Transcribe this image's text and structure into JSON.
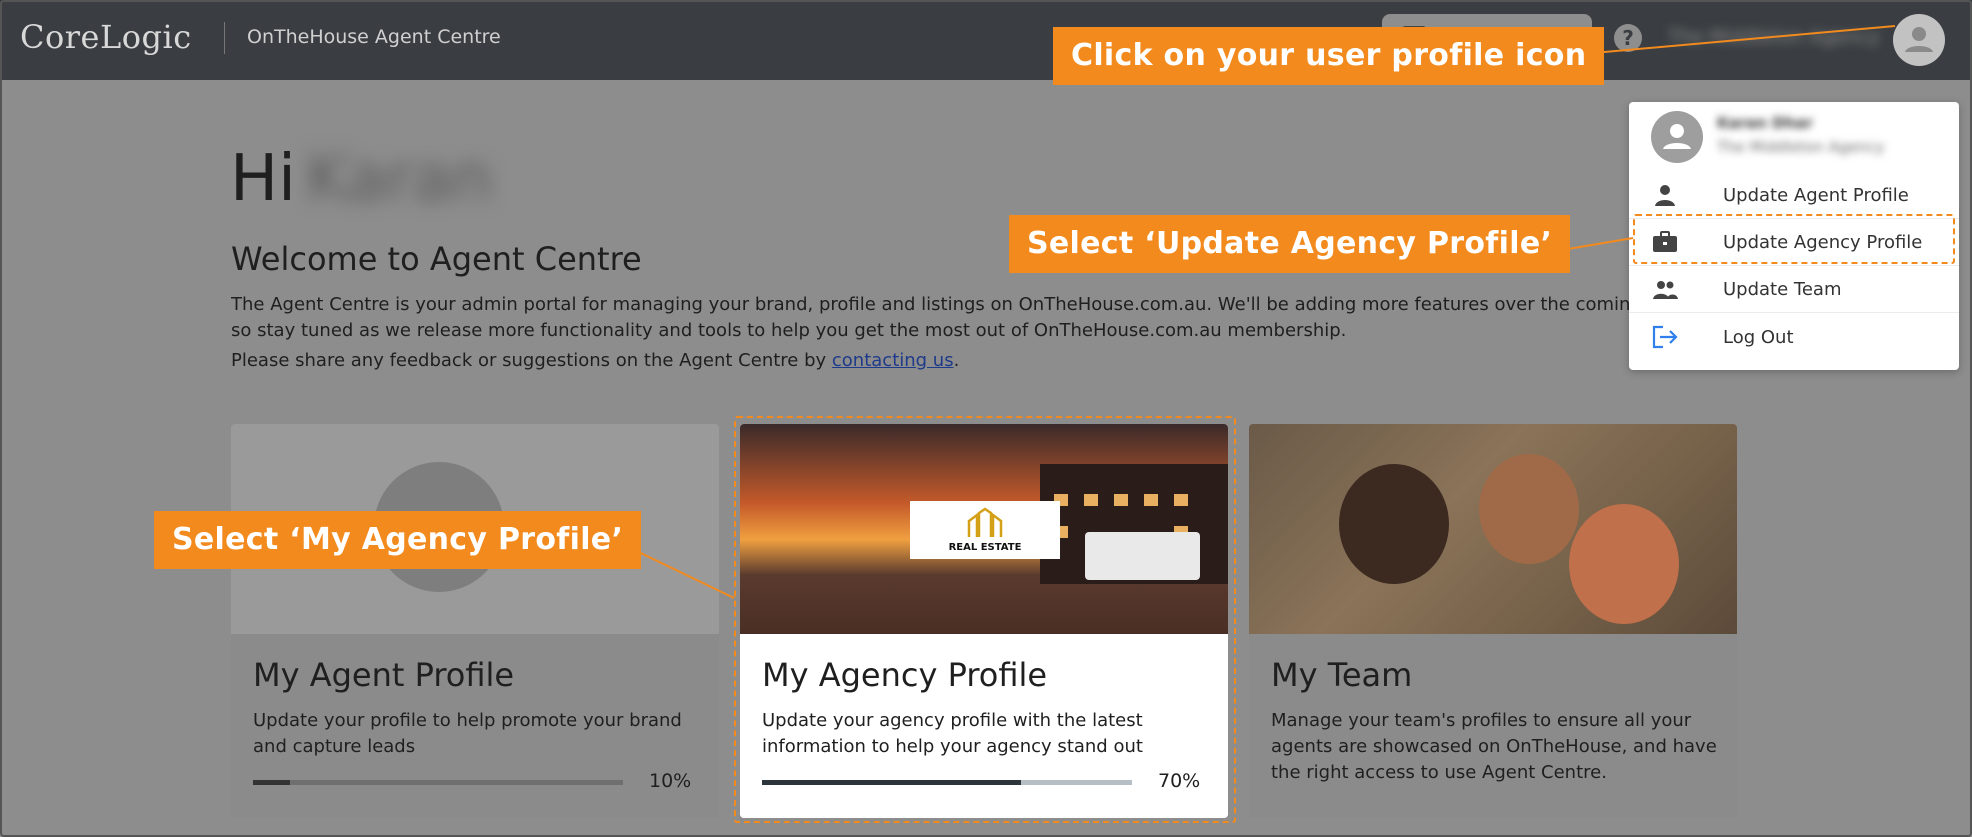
{
  "header": {
    "logo": "CoreLogic",
    "app_name": "OnTheHouse Agent Centre",
    "help": "?",
    "agency_name_blurred": "The Middleton Agency"
  },
  "greeting": {
    "hi": "Hi",
    "name_blurred": "Karan",
    "welcome": "Welcome to Agent Centre",
    "intro_line1": "The Agent Centre is your admin portal for managing your brand, profile and listings on OnTheHouse.com.au. We'll be adding more features over the coming",
    "intro_line2": "so stay tuned as we release more functionality and tools to help you get the most out of OnTheHouse.com.au membership.",
    "feedback_prefix": "Please share any feedback or suggestions on the Agent Centre by ",
    "feedback_link": "contacting us",
    "feedback_suffix": "."
  },
  "cards": [
    {
      "title": "My Agent Profile",
      "description": "Update your profile to help promote your brand and capture leads",
      "progress_label": "10%",
      "progress": 0.1
    },
    {
      "title": "My Agency Profile",
      "description": "Update your agency profile with the latest information to help your agency stand out",
      "progress_label": "70%",
      "progress": 0.7,
      "logo_text": "REAL ESTATE"
    },
    {
      "title": "My Team",
      "description": "Manage your team's profiles to ensure all your agents are showcased on OnTheHouse, and have the right access to use Agent Centre."
    }
  ],
  "dropdown": {
    "user_name_blurred": "Karan Dhar",
    "agency_blurred": "The Middleton Agency",
    "items": [
      {
        "label": "Update Agent Profile",
        "icon": "person-icon"
      },
      {
        "label": "Update Agency Profile",
        "icon": "briefcase-icon"
      },
      {
        "label": "Update Team",
        "icon": "people-icon"
      },
      {
        "label": "Log Out",
        "icon": "logout-icon"
      }
    ]
  },
  "callouts": {
    "profile_icon": "Click on your user profile icon",
    "update_agency": "Select ‘Update Agency Profile’",
    "my_agency": "Select ‘My Agency Profile’"
  },
  "colors": {
    "accent": "#f28a1e",
    "topbar": "#3a3e42",
    "link": "#1e3a8a",
    "logout_icon": "#2f80ed"
  }
}
